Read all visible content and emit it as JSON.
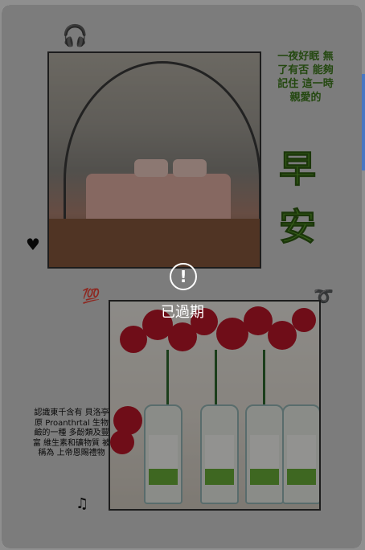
{
  "card": {
    "side_text": "一夜好眠 無了有否 能夠記住 這一時 親愛的",
    "big_char_1": "早",
    "big_char_2": "安",
    "paragraph": "認識東千含有 貝洛亭原 Proanthrtal 生物鹼的一種 多酚類及豐富 維生素和礦物質 被稱為 上帝恩賜禮物",
    "sticker_100": "💯"
  },
  "overlay": {
    "status_icon": "!",
    "status_text": "已過期"
  },
  "colors": {
    "overlay": "#000000",
    "green_text": "#5fa52e",
    "rose_red": "#c0182a"
  },
  "icons": [
    "headphones-icon",
    "heart-icon",
    "music-notes-icon",
    "exclamation-circle-icon"
  ]
}
